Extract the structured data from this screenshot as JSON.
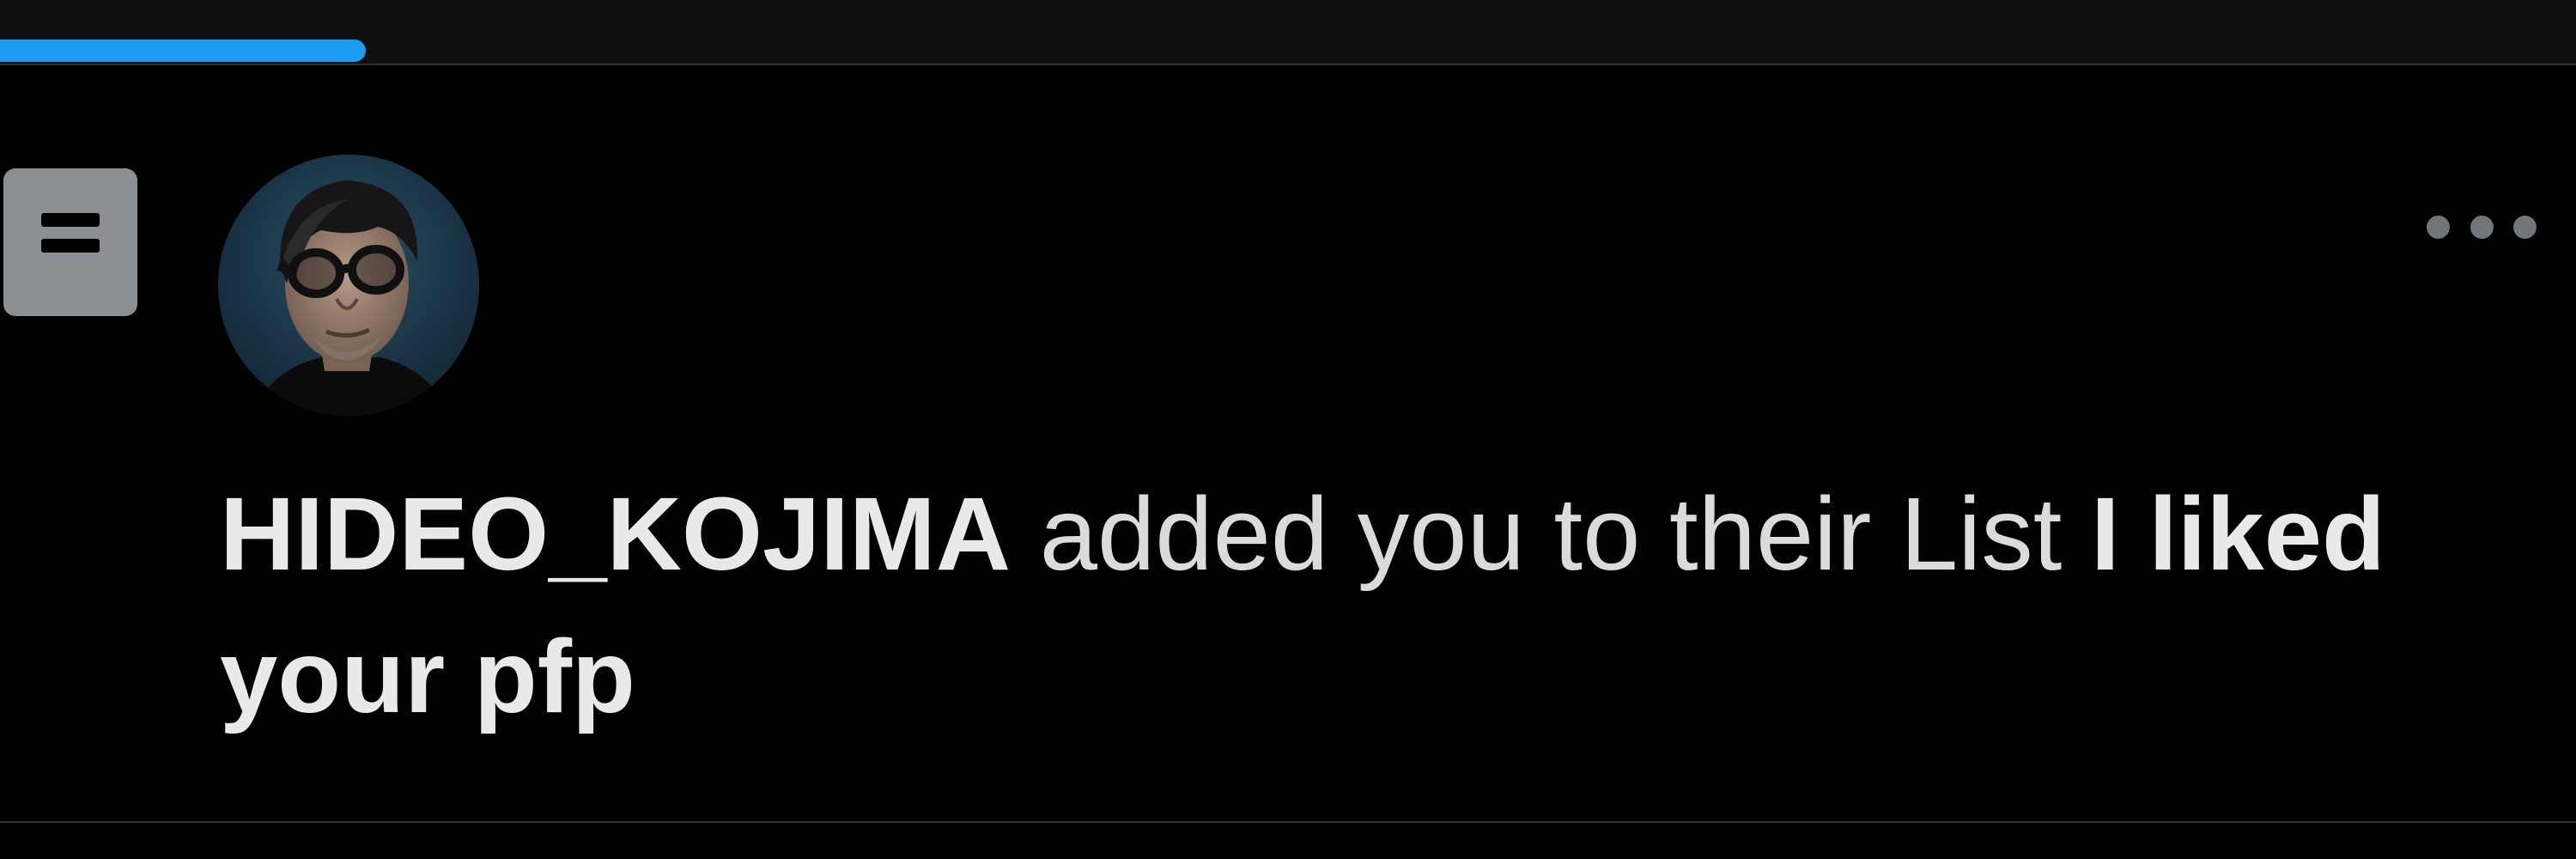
{
  "progress": {
    "fraction": 0.142,
    "color": "#1d9bf0"
  },
  "notification": {
    "type_icon": "list-icon",
    "avatar_icon": "avatar-photo",
    "more_icon": "more-horizontal-icon",
    "actor_name": "HIDEO_KOJIMA",
    "action_text": " added you to their List ",
    "list_name": "I liked your pfp"
  },
  "colors": {
    "background": "#000000",
    "text": "#e7e9ea",
    "accent": "#1d9bf0",
    "icon_gray": "#8b8f94",
    "divider": "#2f3336"
  }
}
